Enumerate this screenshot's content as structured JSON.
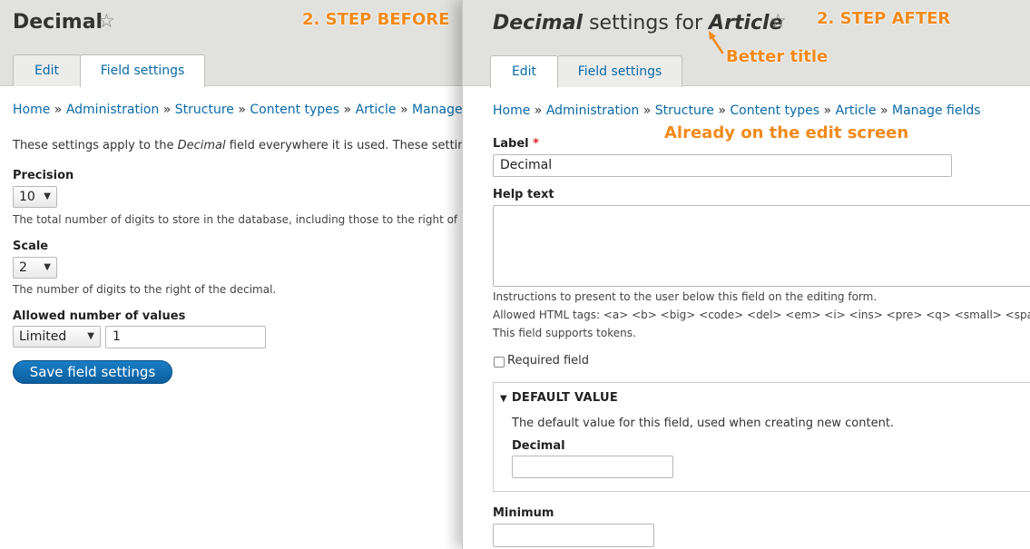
{
  "left": {
    "title": "Decimal",
    "tabs": [
      "Edit",
      "Field settings"
    ],
    "breadcrumb": [
      "Home",
      "Administration",
      "Structure",
      "Content types",
      "Article",
      "Manage fields"
    ],
    "breadcrumb_sep": "»",
    "intro_pre": "These settings apply to the ",
    "intro_em": "Decimal",
    "intro_post": " field everywhere it is used. These settings",
    "precision_label": "Precision",
    "precision_value": "10",
    "precision_desc": "The total number of digits to store in the database, including those to the right of",
    "scale_label": "Scale",
    "scale_value": "2",
    "scale_desc": "The number of digits to the right of the decimal.",
    "allowed_label": "Allowed number of values",
    "allowed_select": "Limited",
    "allowed_input": "1",
    "save_button": "Save field settings"
  },
  "right": {
    "title_em1": "Decimal",
    "title_mid": " settings for ",
    "title_em2": "Article",
    "tabs": [
      "Edit",
      "Field settings"
    ],
    "breadcrumb": [
      "Home",
      "Administration",
      "Structure",
      "Content types",
      "Article",
      "Manage fields"
    ],
    "breadcrumb_sep": "»",
    "label_label": "Label",
    "label_required": "*",
    "label_value": "Decimal",
    "help_label": "Help text",
    "help_desc1": "Instructions to present to the user below this field on the editing form.",
    "help_desc2": "Allowed HTML tags: <a> <b> <big> <code> <del> <em> <i> <ins> <pre> <q> <small> <spa",
    "help_desc3": "This field supports tokens.",
    "required_label": "Required field",
    "default_legend": "DEFAULT VALUE",
    "default_desc": "The default value for this field, used when creating new content.",
    "default_field_label": "Decimal",
    "minimum_label": "Minimum"
  },
  "annotations": {
    "step_before": "2. STEP BEFORE",
    "step_after": "2. STEP AFTER",
    "better_title": "Better title",
    "already_edit": "Already on the edit screen"
  },
  "icons": {
    "star": "star-outline-icon",
    "caret": "caret-down-icon",
    "triangle": "triangle-down-icon",
    "arrow": "arrow-up-left-icon"
  },
  "colors": {
    "link": "#0a6aa8",
    "header_bg": "#e1e1dd",
    "annotation": "#f18a1b",
    "button": "#0b5e9d",
    "required": "#e0212b"
  }
}
